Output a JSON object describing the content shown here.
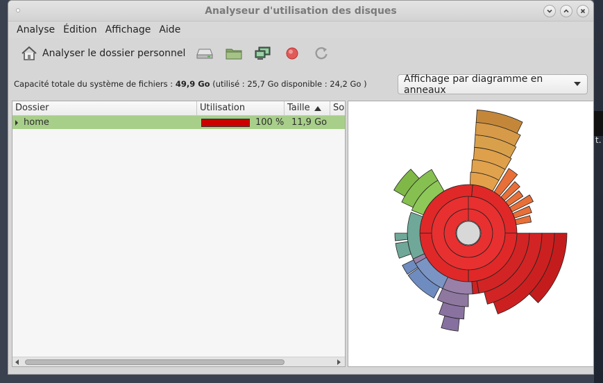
{
  "window": {
    "title": "Analyseur d'utilisation des disques"
  },
  "menu": [
    "Analyse",
    "Édition",
    "Affichage",
    "Aide"
  ],
  "toolbar": {
    "home_label": "Analyser le dossier personnel"
  },
  "capacity": {
    "prefix": "Capacité totale du système de fichiers : ",
    "total": "49,9 Go",
    "detail": " (utilisé : 25,7 Go disponible : 24,2 Go )"
  },
  "view_selector": {
    "value": "Affichage par diagramme en anneaux"
  },
  "table": {
    "headers": [
      "Dossier",
      "Utilisation",
      "Taille",
      "So"
    ],
    "rows": [
      {
        "name": "home",
        "usage_percent": 100,
        "usage_label": "100 %",
        "size": "11,9 Go"
      }
    ]
  },
  "background_fragment": "t.",
  "colors": {
    "selected_row": "#a8cf8a",
    "usage_bar": "#cc0000"
  },
  "icons": [
    "home-icon",
    "drive-icon",
    "folder-icon",
    "network-icon",
    "stop-icon",
    "refresh-icon"
  ]
}
